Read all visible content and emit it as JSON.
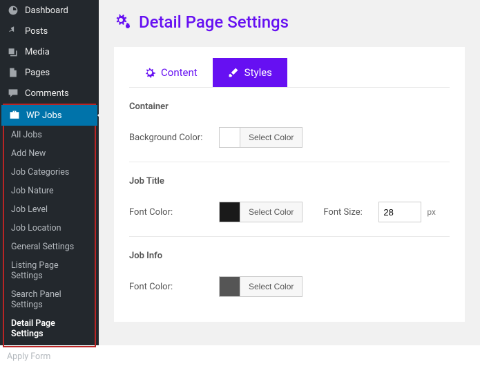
{
  "sidebar": {
    "top": [
      {
        "label": "Dashboard",
        "icon": "dashboard"
      },
      {
        "label": "Posts",
        "icon": "pin"
      },
      {
        "label": "Media",
        "icon": "media"
      },
      {
        "label": "Pages",
        "icon": "page"
      },
      {
        "label": "Comments",
        "icon": "comment"
      }
    ],
    "active_group": {
      "label": "WP Jobs",
      "icon": "briefcase"
    },
    "sub": [
      {
        "label": "All Jobs"
      },
      {
        "label": "Add New"
      },
      {
        "label": "Job Categories"
      },
      {
        "label": "Job Nature"
      },
      {
        "label": "Job Level"
      },
      {
        "label": "Job Location"
      },
      {
        "label": "General Settings"
      },
      {
        "label": "Listing Page Settings"
      },
      {
        "label": "Search Panel Settings"
      },
      {
        "label": "Detail Page Settings",
        "current": true
      }
    ],
    "below": [
      {
        "label": "Apply Form"
      }
    ]
  },
  "page": {
    "title": "Detail Page Settings",
    "tabs": [
      {
        "label": "Content",
        "active": false
      },
      {
        "label": "Styles",
        "active": true
      }
    ],
    "sections": {
      "container": {
        "heading": "Container",
        "bg_label": "Background Color:",
        "select_color": "Select Color"
      },
      "job_title": {
        "heading": "Job Title",
        "font_color_label": "Font Color:",
        "select_color": "Select Color",
        "font_size_label": "Font Size:",
        "font_size_value": "28",
        "unit": "px"
      },
      "job_info": {
        "heading": "Job Info",
        "font_color_label": "Font Color:",
        "select_color": "Select Color"
      }
    }
  }
}
